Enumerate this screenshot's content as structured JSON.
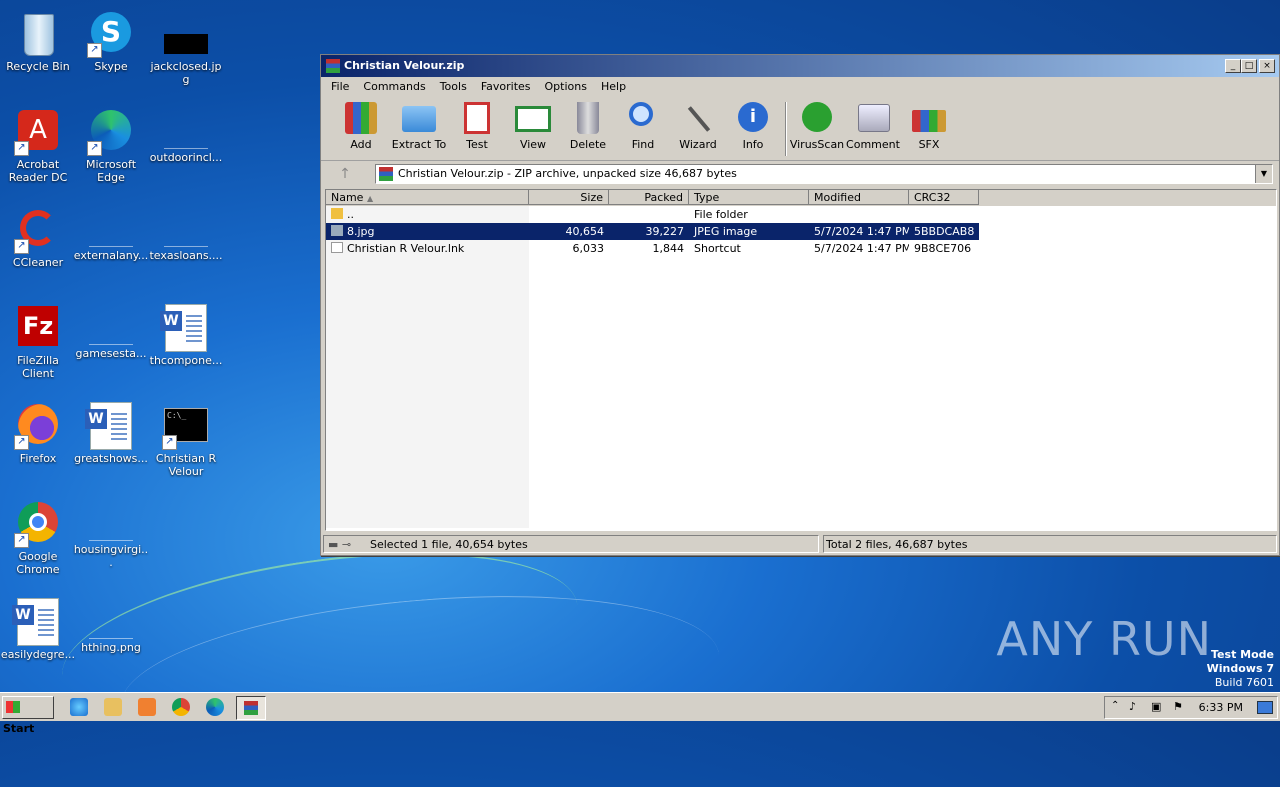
{
  "desktop": {
    "icons": [
      {
        "label": "Recycle Bin"
      },
      {
        "label": "Skype"
      },
      {
        "label": "jackclosed.jpg"
      },
      {
        "label": "Acrobat Reader DC"
      },
      {
        "label": "Microsoft Edge"
      },
      {
        "label": "outdoorincl..."
      },
      {
        "label": "CCleaner"
      },
      {
        "label": "externalany..."
      },
      {
        "label": "texasloans...."
      },
      {
        "label": "FileZilla Client"
      },
      {
        "label": "gamesesta..."
      },
      {
        "label": "thcompone..."
      },
      {
        "label": "Firefox"
      },
      {
        "label": "greatshows..."
      },
      {
        "label": "Christian R Velour"
      },
      {
        "label": "Google Chrome"
      },
      {
        "label": "housingvirgi..."
      },
      {
        "label": "easilydegre..."
      },
      {
        "label": "hthing.png"
      }
    ]
  },
  "window": {
    "title": "Christian Velour.zip",
    "controls": {
      "minimize": "_",
      "maximize": "□",
      "close": "×"
    },
    "menu": [
      "File",
      "Commands",
      "Tools",
      "Favorites",
      "Options",
      "Help"
    ],
    "toolbar": [
      {
        "label": "Add",
        "icon": "add-archive-icon"
      },
      {
        "label": "Extract To",
        "icon": "extract-folder-icon"
      },
      {
        "label": "Test",
        "icon": "test-clipboard-icon"
      },
      {
        "label": "View",
        "icon": "view-book-icon"
      },
      {
        "label": "Delete",
        "icon": "trash-icon"
      },
      {
        "label": "Find",
        "icon": "magnifier-icon"
      },
      {
        "label": "Wizard",
        "icon": "wand-icon"
      },
      {
        "label": "Info",
        "icon": "info-icon"
      },
      {
        "label": "VirusScan",
        "icon": "bug-icon"
      },
      {
        "label": "Comment",
        "icon": "comment-icon"
      },
      {
        "label": "SFX",
        "icon": "sfx-box-icon"
      }
    ],
    "address": "Christian Velour.zip - ZIP archive, unpacked size 46,687 bytes",
    "columns": [
      "Name",
      "Size",
      "Packed",
      "Type",
      "Modified",
      "CRC32"
    ],
    "rows": [
      {
        "name": "..",
        "size": "",
        "packed": "",
        "type": "File folder",
        "modified": "",
        "crc": ""
      },
      {
        "name": "8.jpg",
        "size": "40,654",
        "packed": "39,227",
        "type": "JPEG image",
        "modified": "5/7/2024 1:47 PM",
        "crc": "5BBDCAB8"
      },
      {
        "name": "Christian R Velour.lnk",
        "size": "6,033",
        "packed": "1,844",
        "type": "Shortcut",
        "modified": "5/7/2024 1:47 PM",
        "crc": "9B8CE706"
      }
    ],
    "status_left": "Selected 1 file, 40,654 bytes",
    "status_right": "Total 2 files, 46,687 bytes"
  },
  "taskbar": {
    "start": "Start",
    "clock": "6:33 PM"
  },
  "watermark": "ANY RUN",
  "testmode": {
    "line1": "Test Mode",
    "line2": "Windows 7",
    "line3": "Build 7601"
  }
}
